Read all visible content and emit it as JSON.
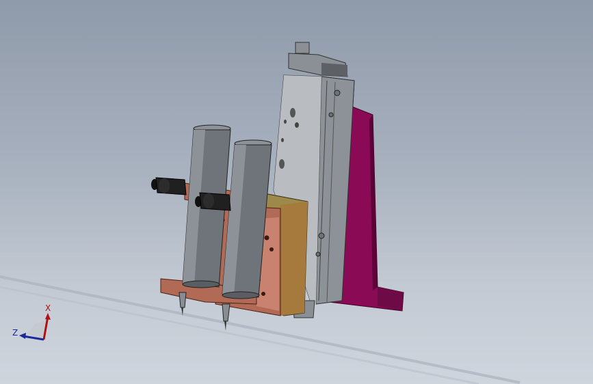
{
  "viewport": {
    "background_top": "#8f9aaa",
    "background_bottom": "#cfd5dd"
  },
  "model": {
    "colors": {
      "bracket": "#8a0a55",
      "bracket_shadow": "#5e0038",
      "slide_body": "#a9aeb4",
      "slide_dark": "#6e7278",
      "plate_copper": "#b06a55",
      "plate_copper_dark": "#6b3325",
      "plate_brass": "#9d8a4a",
      "cylinder": "#6f747a",
      "cylinder_light": "#8d9298",
      "fitting": "#202020"
    }
  },
  "triad": {
    "x_label": "X",
    "z_label": "Z",
    "x_color": "#b01010",
    "z_color": "#1a2a9a"
  }
}
